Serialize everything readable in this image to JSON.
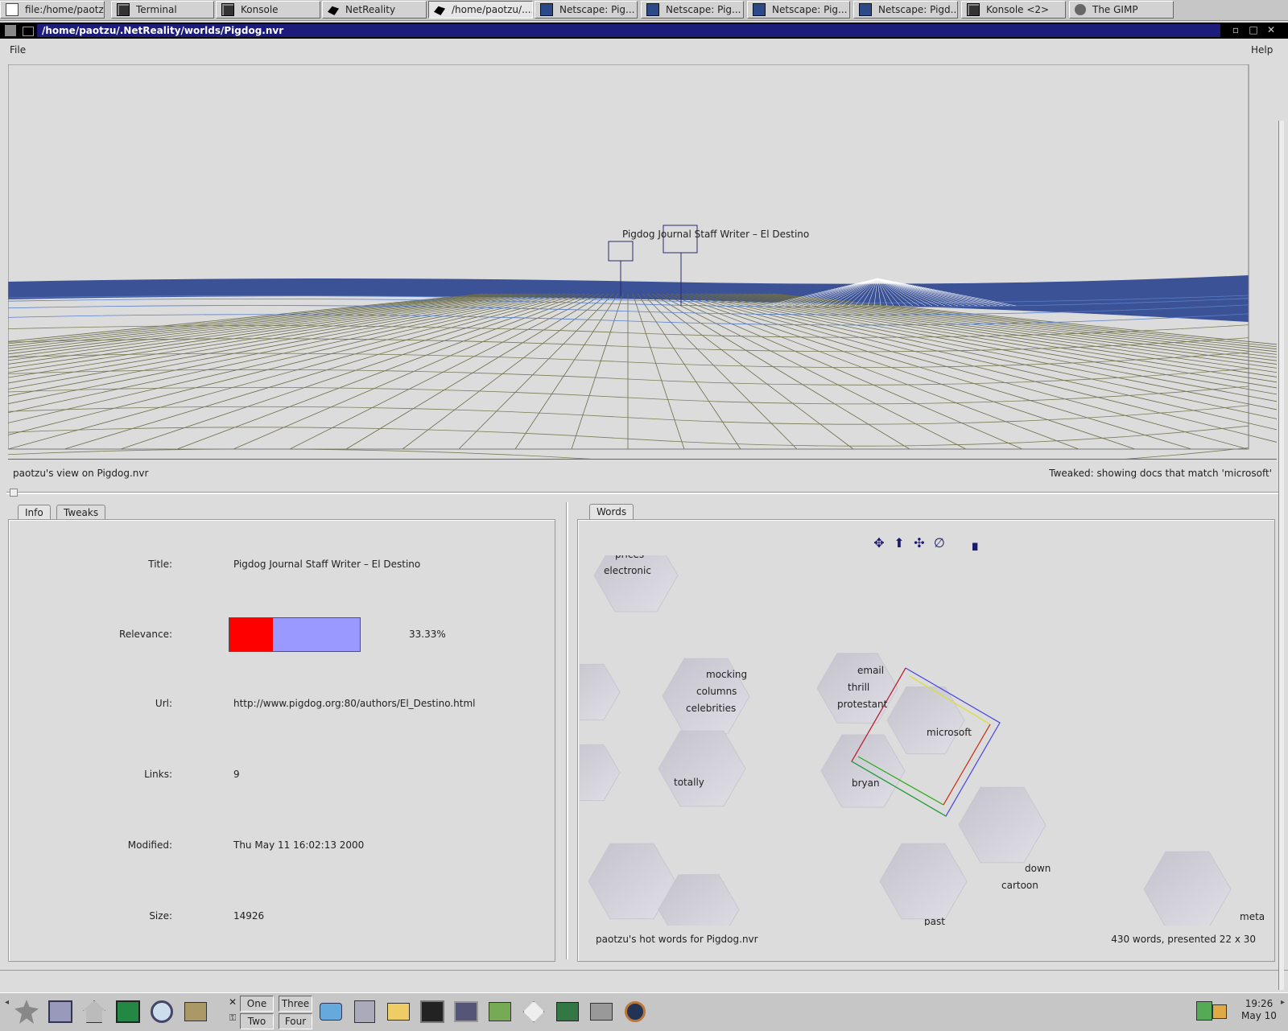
{
  "taskbar": {
    "items": [
      {
        "label": "file:/home/paotzu/"
      },
      {
        "label": "Terminal"
      },
      {
        "label": "Konsole"
      },
      {
        "label": "NetReality"
      },
      {
        "label": "/home/paotzu/...."
      },
      {
        "label": "Netscape: Pig..."
      },
      {
        "label": "Netscape: Pig..."
      },
      {
        "label": "Netscape: Pig..."
      },
      {
        "label": "Netscape: Pigd..."
      },
      {
        "label": "Konsole <2>"
      },
      {
        "label": "The GIMP"
      }
    ]
  },
  "window": {
    "title": "/home/paotzu/.NetReality/worlds/Pigdog.nvr"
  },
  "menubar": {
    "file": "File",
    "help": "Help"
  },
  "view": {
    "node_label": "Pigdog Journal Staff Writer – El Destino",
    "caption_left": "paotzu's view on Pigdog.nvr",
    "caption_right": "Tweaked: showing docs that match 'microsoft'"
  },
  "tabs_left": {
    "info": "Info",
    "tweaks": "Tweaks"
  },
  "info": {
    "title_label": "Title:",
    "title_value": "Pigdog Journal Staff Writer – El Destino",
    "relevance_label": "Relevance:",
    "relevance_fraction": 0.3333,
    "relevance_text": "33.33%",
    "url_label": "Url:",
    "url_value": "http://www.pigdog.org:80/authors/El_Destino.html",
    "links_label": "Links:",
    "links_value": "9",
    "modified_label": "Modified:",
    "modified_value": "Thu May 11 16:02:13 2000",
    "size_label": "Size:",
    "size_value": "14926"
  },
  "words": {
    "tab": "Words",
    "caption_left": "paotzu's hot words for Pigdog.nvr",
    "caption_right": "430 words, presented 22 x 30",
    "labels": {
      "prices": "prices",
      "electronic": "electronic",
      "mocking": "mocking",
      "columns": "columns",
      "celebrities": "celebrities",
      "email": "email",
      "thrill": "thrill",
      "protestant": "protestant",
      "microsoft": "microsoft",
      "totally": "totally",
      "bryan": "bryan",
      "down": "down",
      "cartoon": "cartoon",
      "past": "past",
      "meta": "meta"
    }
  },
  "panel": {
    "desktops": [
      "One",
      "Two",
      "Three",
      "Four"
    ],
    "clock_time": "19:26",
    "clock_date": "May 10"
  },
  "colors": {
    "relevance_fill": "#ff0000",
    "relevance_track": "#9999ff",
    "title_bg": "#1c1c7a"
  }
}
